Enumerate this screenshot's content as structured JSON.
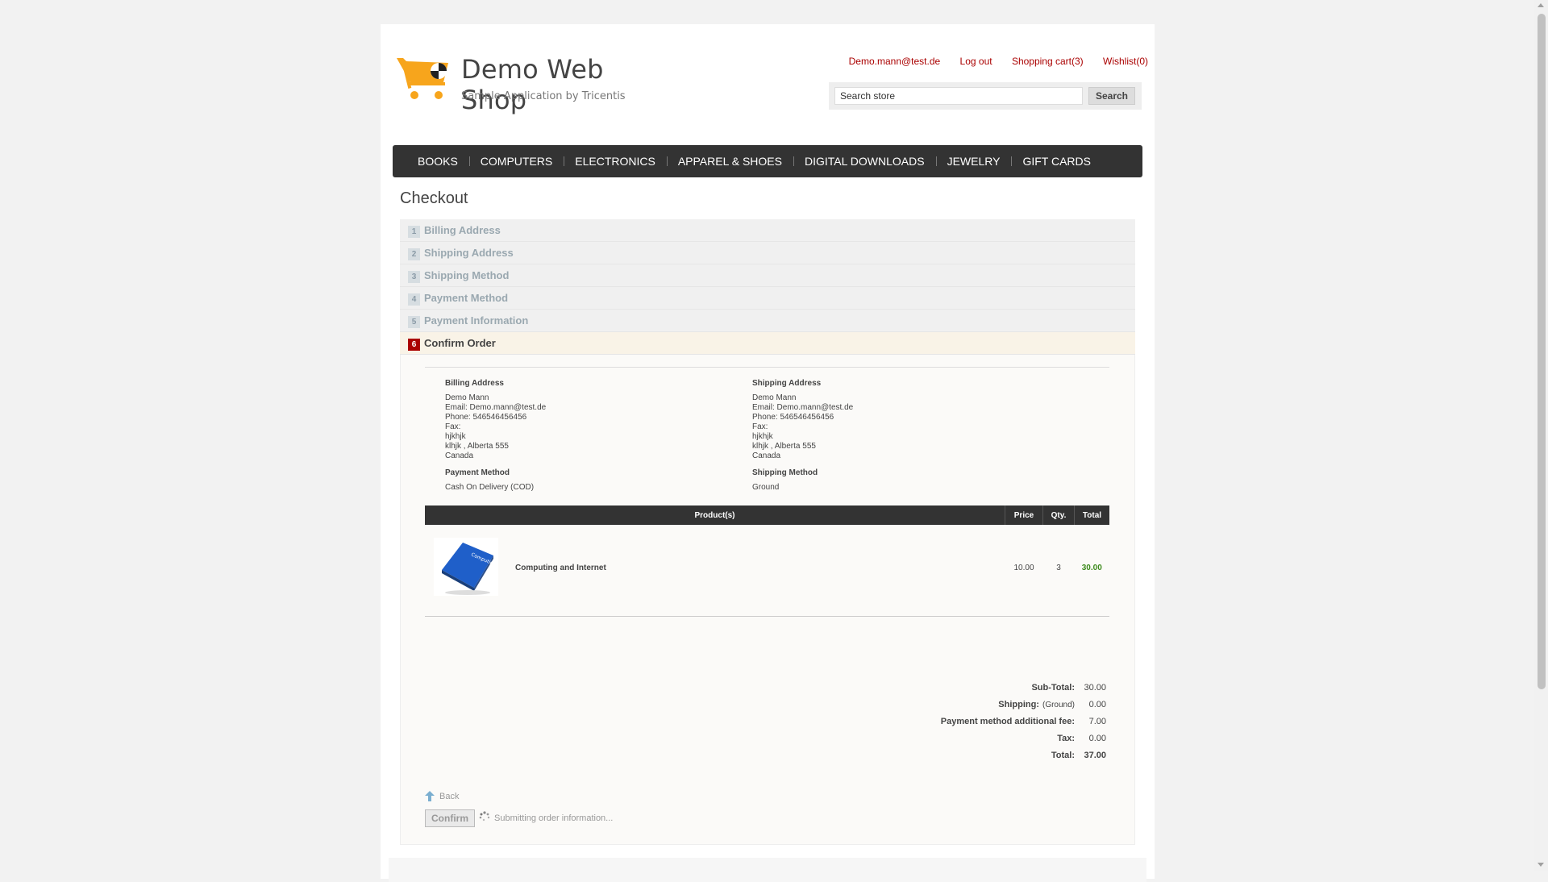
{
  "header": {
    "title": "Demo Web Shop",
    "subtitle": "Sample Application by Tricentis",
    "links": [
      "Demo.mann@test.de",
      "Log out",
      "Shopping cart(3)",
      "Wishlist(0)"
    ],
    "search_value": "Search store",
    "search_button": "Search"
  },
  "menu": [
    "BOOKS",
    "COMPUTERS",
    "ELECTRONICS",
    "APPAREL & SHOES",
    "DIGITAL DOWNLOADS",
    "JEWELRY",
    "GIFT CARDS"
  ],
  "checkout": {
    "title": "Checkout",
    "steps": [
      {
        "num": "1",
        "label": "Billing Address"
      },
      {
        "num": "2",
        "label": "Shipping Address"
      },
      {
        "num": "3",
        "label": "Shipping Method"
      },
      {
        "num": "4",
        "label": "Payment Method"
      },
      {
        "num": "5",
        "label": "Payment Information"
      },
      {
        "num": "6",
        "label": "Confirm Order"
      }
    ],
    "billing": {
      "heading": "Billing Address",
      "lines": [
        "Demo Mann",
        "Email: Demo.mann@test.de",
        "Phone: 546546456456",
        "Fax:",
        "hjkhjk",
        "klhjk , Alberta 555",
        "Canada"
      ]
    },
    "shipping": {
      "heading": "Shipping Address",
      "lines": [
        "Demo Mann",
        "Email: Demo.mann@test.de",
        "Phone: 546546456456",
        "Fax:",
        "hjkhjk",
        "klhjk , Alberta 555",
        "Canada"
      ]
    },
    "payment_method": {
      "heading": "Payment Method",
      "value": "Cash On Delivery (COD)"
    },
    "shipping_method": {
      "heading": "Shipping Method",
      "value": "Ground"
    },
    "table": {
      "headers": [
        "Product(s)",
        "Price",
        "Qty.",
        "Total"
      ],
      "rows": [
        {
          "product": "Computing and Internet",
          "price": "10.00",
          "qty": "3",
          "total": "30.00",
          "image_text": "Computing and Internet"
        }
      ]
    },
    "totals": {
      "subtotal_label": "Sub-Total:",
      "subtotal": "30.00",
      "shipping_label": "Shipping:",
      "shipping_note": "(Ground)",
      "shipping": "0.00",
      "fee_label": "Payment method additional fee:",
      "fee": "7.00",
      "tax_label": "Tax:",
      "tax": "0.00",
      "total_label": "Total:",
      "total": "37.00"
    },
    "back_label": "Back",
    "confirm_label": "Confirm",
    "submitting_text": "Submitting order information..."
  },
  "colors": {
    "accent": "#aa0000",
    "menu_bg": "#333333",
    "price_green": "#3c8a1c",
    "logo_orange": "#f7a51c"
  }
}
